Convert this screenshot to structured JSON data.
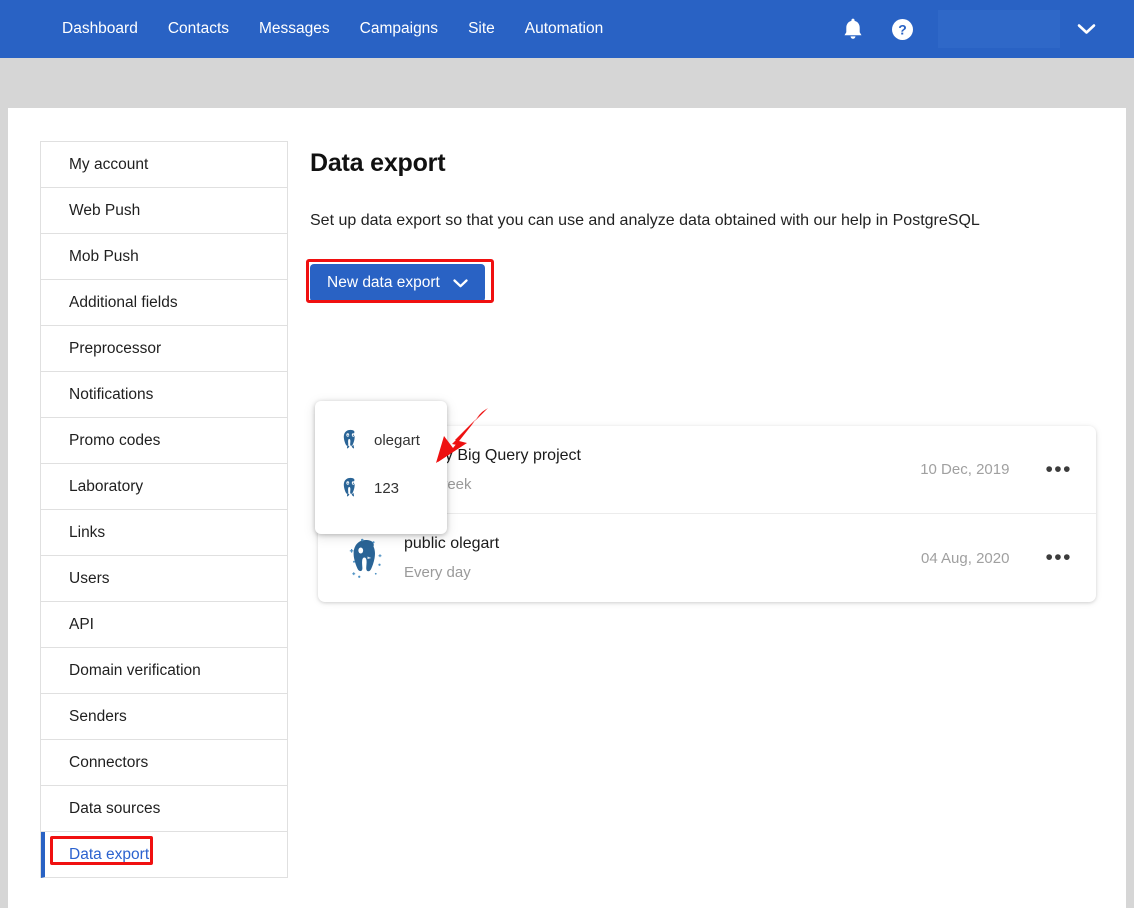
{
  "topnav": {
    "links": [
      {
        "label": "Dashboard"
      },
      {
        "label": "Contacts"
      },
      {
        "label": "Messages"
      },
      {
        "label": "Campaigns"
      },
      {
        "label": "Site"
      },
      {
        "label": "Automation"
      }
    ],
    "icons": {
      "notifications": "bell-icon",
      "help": "question-mark-circle-icon",
      "account_chevron": "chevron-down-icon"
    },
    "brand_color": "#2962c4"
  },
  "sidebar": {
    "items": [
      {
        "label": "My account",
        "active": false
      },
      {
        "label": "Web Push",
        "active": false
      },
      {
        "label": "Mob Push",
        "active": false
      },
      {
        "label": "Additional fields",
        "active": false
      },
      {
        "label": "Preprocessor",
        "active": false
      },
      {
        "label": "Notifications",
        "active": false
      },
      {
        "label": "Promo codes",
        "active": false
      },
      {
        "label": "Laboratory",
        "active": false
      },
      {
        "label": "Links",
        "active": false
      },
      {
        "label": "Users",
        "active": false
      },
      {
        "label": "API",
        "active": false
      },
      {
        "label": "Domain verification",
        "active": false
      },
      {
        "label": "Senders",
        "active": false
      },
      {
        "label": "Connectors",
        "active": false
      },
      {
        "label": "Data sources",
        "active": false
      },
      {
        "label": "Data export",
        "active": true
      }
    ],
    "active_color": "#2b62cf"
  },
  "main": {
    "title": "Data export",
    "description": "Set up data export so that you can use and analyze data obtained with our help in PostgreSQL",
    "new_export_button": {
      "label": "New data export",
      "chevron": "chevron-down-icon"
    },
    "dropdown": {
      "open": true,
      "items": [
        {
          "label": "olegart",
          "icon": "postgresql-elephant-icon"
        },
        {
          "label": "123",
          "icon": "postgresql-elephant-icon"
        }
      ]
    },
    "export_rows": [
      {
        "title": "estKey  Big Query project",
        "schedule": "very week",
        "date": "10 Dec, 2019",
        "menu": "•••",
        "icon": "postgresql-elephant-icon"
      },
      {
        "title": "public  olegart",
        "schedule": "Every day",
        "date": "04 Aug, 2020",
        "menu": "•••",
        "icon": "postgresql-elephant-icon"
      }
    ]
  },
  "annotations": {
    "color": "#f01010",
    "button_highlight": "red-rectangle-around-new-data-export-button",
    "sidebar_highlight": "red-rectangle-around-data-export-item",
    "arrow": "red-arrow-pointing-to-dropdown"
  }
}
